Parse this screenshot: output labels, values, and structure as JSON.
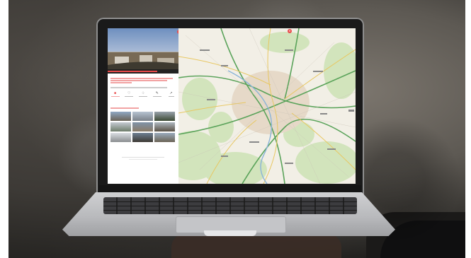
{
  "colors": {
    "accent": "#e94a4a",
    "map_land": "#f2efe6",
    "forest": "#cfe3b8",
    "road_major": "#5aa35a",
    "road_minor": "#e8c760"
  },
  "icons": [
    "close-icon",
    "webcam-icon",
    "favorite-icon",
    "like-icon",
    "edit-icon",
    "share-icon"
  ]
}
